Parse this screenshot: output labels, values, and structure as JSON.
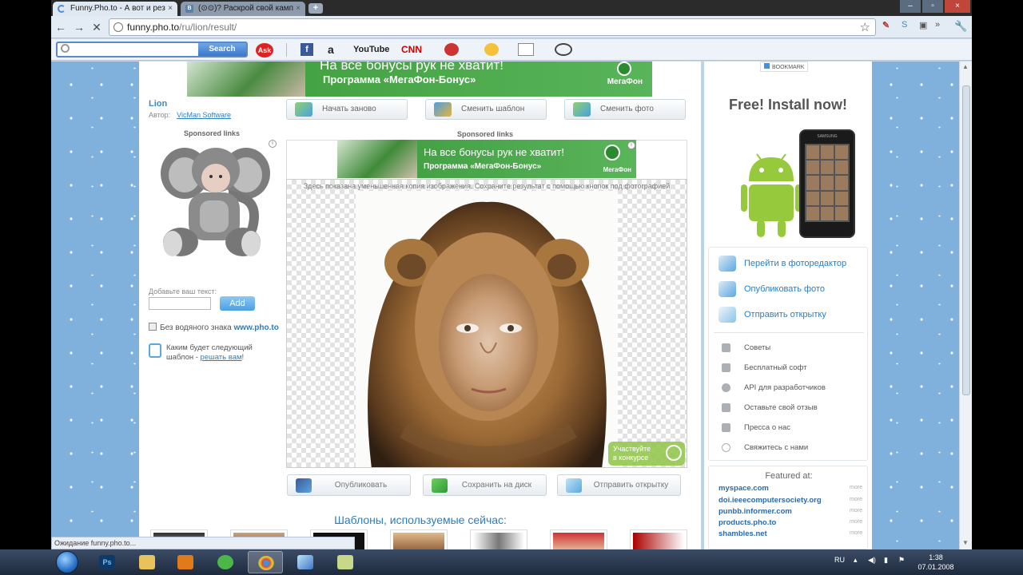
{
  "browser": {
    "tabs": [
      {
        "label": "Funny.Pho.to - А вот и рез",
        "active": true
      },
      {
        "label": "(⊙⊙)? Раскрой свой камп",
        "active": false
      }
    ],
    "new_tab": "+",
    "url_host": "funny.pho.to",
    "url_path": "/ru/lion/result/",
    "status_text": "Ожидание funny.pho.to..."
  },
  "toolbar": {
    "search_placeholder": "",
    "search_button": "Search",
    "ask_label": "Ask",
    "facebook": "f",
    "amazon": "a",
    "youtube": "YouTube",
    "cnn": "CNN"
  },
  "page": {
    "banner_top": {
      "line1": "На все бонусы рук не хватит!",
      "line2": "Программа «МегаФон-Бонус»",
      "logo": "МегаФон"
    },
    "template_title": "Lion",
    "author_label": "Автор:",
    "author_name": "VicMan Software",
    "sponsored_left": "Sponsored links",
    "sponsored_center": "Sponsored links",
    "add_text_label": "Добавьте ваш текст:",
    "add_text_value": "",
    "add_button": "Add",
    "no_watermark_label": "Без водяного знака",
    "no_watermark_brand": "www.pho.to",
    "next_template_text": "Каким будет следующий шаблон -",
    "next_template_link": "решать вам",
    "next_template_end": "!",
    "top_buttons": [
      "Начать заново",
      "Сменить шаблон",
      "Сменить фото"
    ],
    "banner_center": {
      "line1": "На все бонусы рук не хватит!",
      "line2": "Программа «МегаФон-Бонус»",
      "logo": "МегаФон"
    },
    "result_note": "Здесь показана уменьшенная копия изображения. Сохраните результат с помощью кнопок под фотографией",
    "contest_label_1": "Участвуйте",
    "contest_label_2": "в конкурсе",
    "bottom_buttons": [
      "Опубликовать",
      "Сохранить на диск",
      "Отправить открытку"
    ],
    "templates_title": "Шаблоны, используемые сейчас:"
  },
  "right": {
    "bookmark": "BOOKMARK",
    "free_install": "Free! Install now!",
    "phone_brand": "SAMSUNG",
    "actions": [
      "Перейти в фоторедактор",
      "Опубликовать фото",
      "Отправить открытку"
    ],
    "links": [
      "Советы",
      "Бесплатный софт",
      "API для разработчиков",
      "Оставьте свой отзыв",
      "Пресса о нас",
      "Свяжитесь с нами"
    ],
    "featured_title": "Featured at:",
    "featured": [
      "myspace.com",
      "doi.ieeecomputersociety.org",
      "punbb.informer.com",
      "products.pho.to",
      "shambles.net"
    ],
    "more_label": "more"
  },
  "taskbar": {
    "lang": "RU",
    "time": "1:38",
    "date": "07.01.2008",
    "ps_label": "Ps"
  }
}
